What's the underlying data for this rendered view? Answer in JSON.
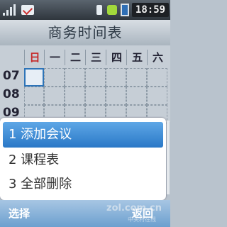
{
  "status_bar": {
    "time": "18:59",
    "icons": [
      "signal-icon",
      "message-icon",
      "alarm-icon",
      "vibrate-icon",
      "battery-icon"
    ]
  },
  "header": {
    "title": "商务时间表"
  },
  "schedule": {
    "days": [
      "日",
      "一",
      "二",
      "三",
      "四",
      "五",
      "六"
    ],
    "hours": [
      "07",
      "08",
      "09"
    ],
    "colors": {
      "sunday": "#c62828",
      "selected_border": "#2e74b8"
    }
  },
  "menu": {
    "items": [
      {
        "label": "1 添加会议"
      },
      {
        "label": "2 课程表"
      },
      {
        "label": "3 全部删除"
      }
    ],
    "active_index": 0
  },
  "softkeys": {
    "left": "选择",
    "right": "返回"
  },
  "watermark": {
    "logo": "ZOL",
    "text": "zol.com.cn",
    "subtext": "中关村在线"
  }
}
